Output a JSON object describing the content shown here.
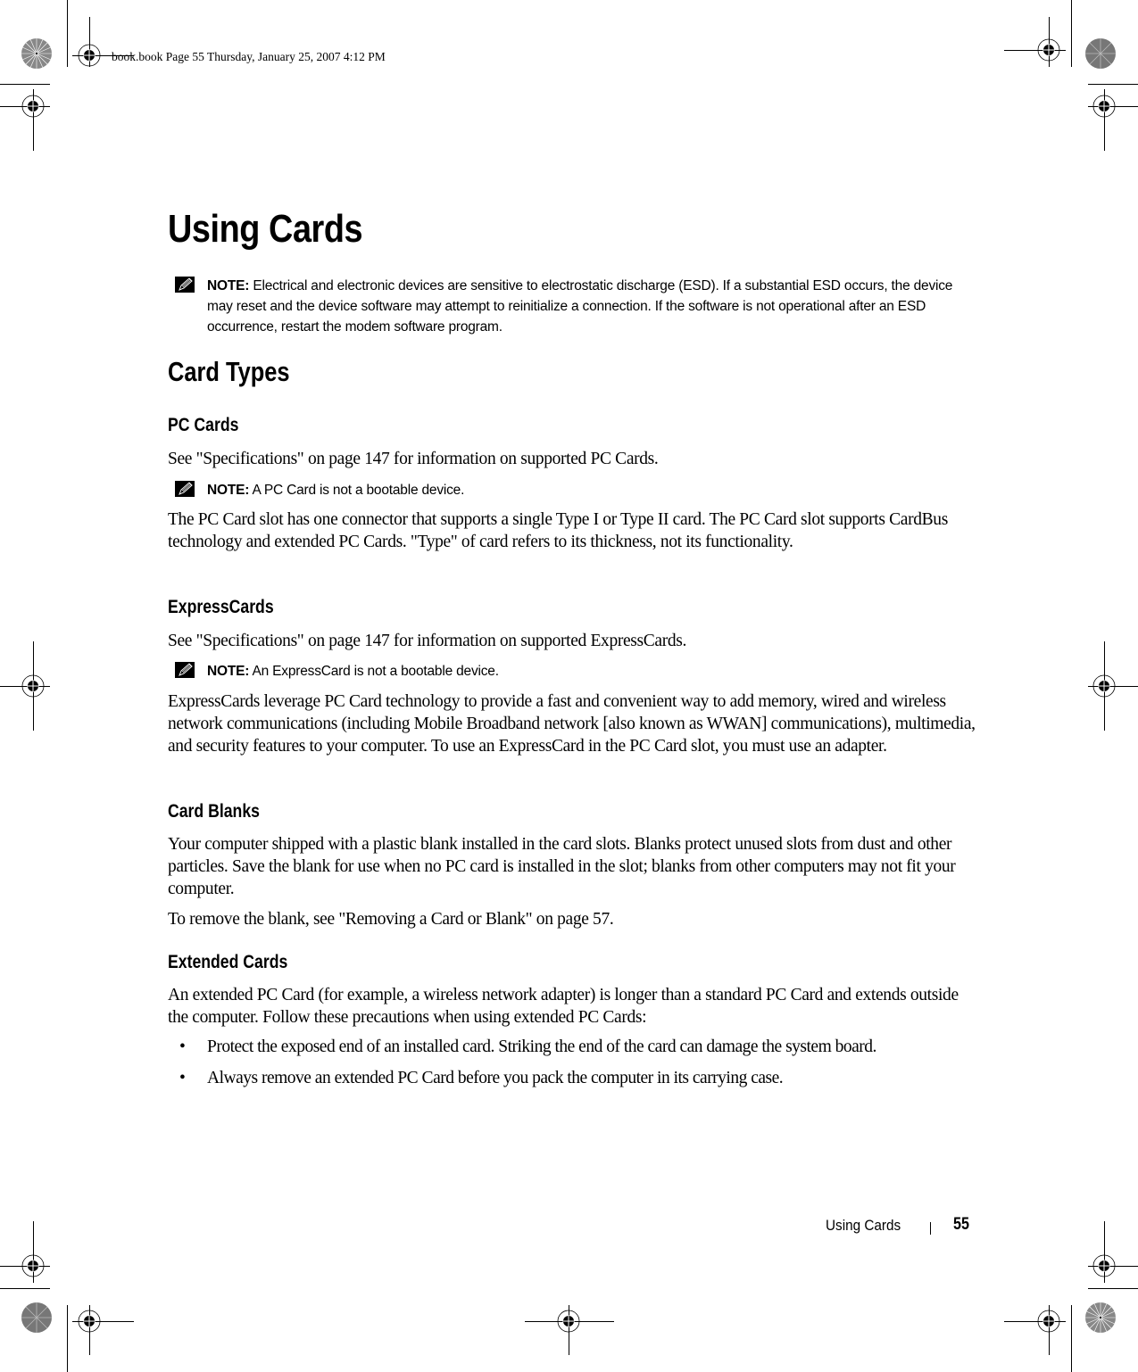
{
  "slug_line": "book.book  Page 55  Thursday, January 25, 2007  4:12 PM",
  "page_title": "Using Cards",
  "notes": {
    "label": "NOTE:",
    "esd": "Electrical and electronic devices are sensitive to electrostatic discharge (ESD). If a substantial ESD occurs, the device may reset and the device software may attempt to reinitialize a connection. If the software is not operational after an ESD occurrence, restart the modem software program.",
    "pc_card": "A PC Card is not a bootable device.",
    "express_card": "An ExpressCard is not a bootable device."
  },
  "section_title": "Card Types",
  "sections": {
    "pc_cards": {
      "heading": "PC Cards",
      "see_spec": "See \"Specifications\" on page 147 for information on supported PC Cards.",
      "paragraph": "The PC Card slot has one connector that supports a single Type I or Type II card. The PC Card slot supports CardBus technology and extended PC Cards. \"Type\" of card refers to its thickness, not its functionality."
    },
    "express_cards": {
      "heading": "ExpressCards",
      "see_spec": "See \"Specifications\" on page 147 for information on supported ExpressCards.",
      "paragraph": "ExpressCards leverage PC Card technology to provide a fast and convenient way to add memory, wired and wireless network communications (including Mobile Broadband network [also known as WWAN] communications), multimedia, and security features to your computer. To use an ExpressCard in the PC Card slot, you must use an adapter."
    },
    "card_blanks": {
      "heading": "Card Blanks",
      "paragraph": "Your computer shipped with a plastic blank installed in the card slots. Blanks protect unused slots from dust and other particles. Save the blank for use when no PC card is installed in the slot; blanks from other computers may not fit your computer.",
      "remove_ref": "To remove the blank, see \"Removing a Card or Blank\" on page 57."
    },
    "extended_cards": {
      "heading": "Extended Cards",
      "paragraph": "An extended PC Card (for example, a wireless network adapter) is longer than a standard PC Card and extends outside the computer. Follow these precautions when using extended PC Cards:",
      "bullets": [
        "Protect the exposed end of an installed card. Striking the end of the card can damage the system board.",
        "Always remove an extended PC Card before you pack the computer in its carrying case."
      ]
    }
  },
  "footer": {
    "chapter": "Using Cards",
    "page_number": "55"
  },
  "bullet_glyph": "•"
}
